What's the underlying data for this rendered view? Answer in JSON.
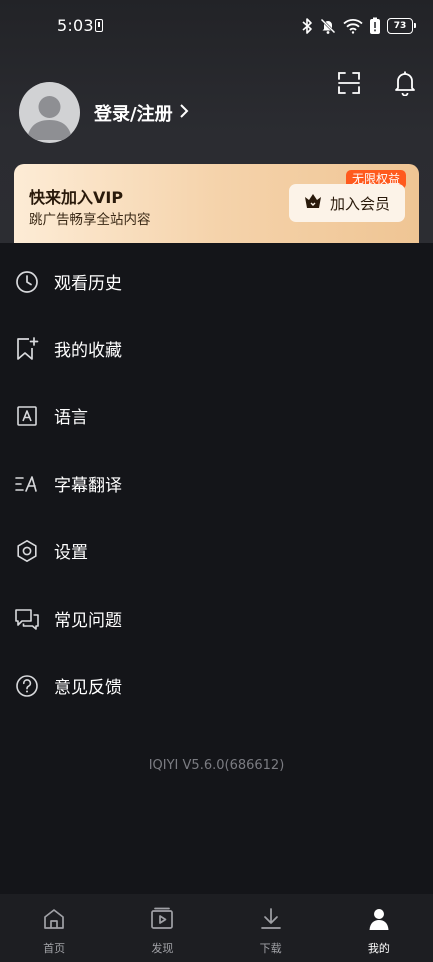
{
  "status_bar": {
    "time": "5:03",
    "battery": "73"
  },
  "header": {
    "scan_icon": "scan-icon",
    "bell_icon": "bell-icon",
    "login_label": "登录/注册"
  },
  "vip": {
    "title": "快来加入VIP",
    "subtitle": "跳广告畅享全站内容",
    "badge": "无限权益",
    "button_label": "加入会员",
    "accent": "#ff5a1d"
  },
  "menu": {
    "items": [
      {
        "label": "观看历史",
        "icon": "clock-icon"
      },
      {
        "label": "我的收藏",
        "icon": "bookmark-icon"
      },
      {
        "label": "语言",
        "icon": "language-icon"
      },
      {
        "label": "字幕翻译",
        "icon": "subtitle-icon"
      },
      {
        "label": "设置",
        "icon": "gear-icon"
      },
      {
        "label": "常见问题",
        "icon": "chat-icon"
      },
      {
        "label": "意见反馈",
        "icon": "help-icon"
      }
    ]
  },
  "version": "IQIYI V5.6.0(686612)",
  "bottom_nav": {
    "items": [
      {
        "label": "首页",
        "icon": "home-icon"
      },
      {
        "label": "发现",
        "icon": "discover-icon"
      },
      {
        "label": "下载",
        "icon": "download-icon"
      },
      {
        "label": "我的",
        "icon": "profile-icon",
        "active": true
      }
    ]
  }
}
